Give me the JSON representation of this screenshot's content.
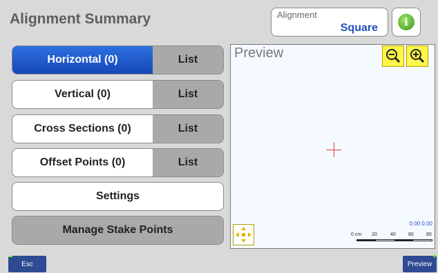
{
  "header": {
    "title": "Alignment Summary"
  },
  "alignment": {
    "label": "Alignment",
    "value": "Square"
  },
  "info": {
    "glyph": "i"
  },
  "rows": [
    {
      "label": "Horizontal (0)",
      "list": "List"
    },
    {
      "label": "Vertical (0)",
      "list": "List"
    },
    {
      "label": "Cross Sections (0)",
      "list": "List"
    },
    {
      "label": "Offset Points (0)",
      "list": "List"
    }
  ],
  "settings_label": "Settings",
  "manage_label": "Manage Stake Points",
  "preview": {
    "title": "Preview",
    "scale_values": "0.00 0.00",
    "scale_labels": [
      "0 cm",
      "20",
      "40",
      "60",
      "80"
    ]
  },
  "softkeys": {
    "esc": "Esc",
    "preview": "Preview"
  },
  "colors": {
    "accent": "#1f4fbf",
    "active_button": "#1548b8",
    "zoom_button": "#fff64a",
    "crosshair": "#e04040"
  }
}
